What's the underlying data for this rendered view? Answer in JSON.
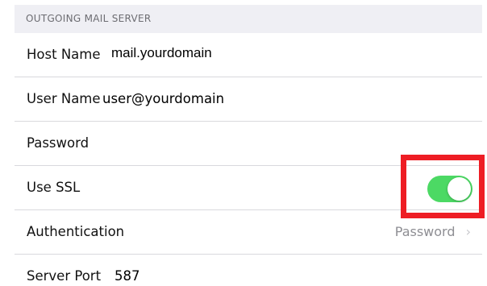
{
  "section": {
    "title": "OUTGOING MAIL SERVER"
  },
  "rows": {
    "host_name": {
      "label": "Host Name",
      "value": "mail.yourdomain"
    },
    "user_name": {
      "label": "User Name",
      "value": "user@yourdomain"
    },
    "password": {
      "label": "Password"
    },
    "use_ssl": {
      "label": "Use SSL",
      "enabled": true
    },
    "authentication": {
      "label": "Authentication",
      "value": "Password",
      "chevron": "›"
    },
    "server_port": {
      "label": "Server Port",
      "value": "587"
    }
  },
  "colors": {
    "toggle_on": "#4cd964",
    "highlight": "#ee1d24",
    "header_bg": "#efeff4",
    "secondary_text": "#8e8e93"
  },
  "icons": {
    "disclosure": "chevron-right-icon"
  }
}
